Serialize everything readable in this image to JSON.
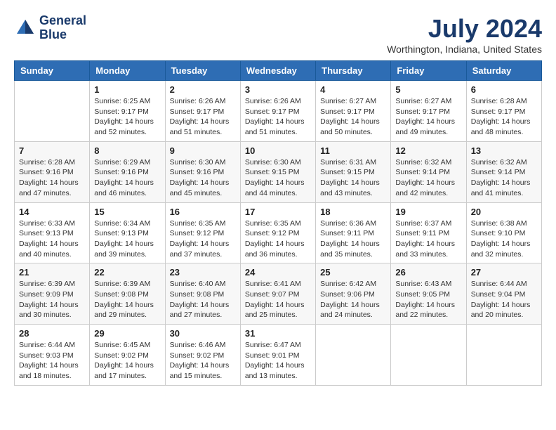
{
  "header": {
    "logo_line1": "General",
    "logo_line2": "Blue",
    "month_title": "July 2024",
    "location": "Worthington, Indiana, United States"
  },
  "weekdays": [
    "Sunday",
    "Monday",
    "Tuesday",
    "Wednesday",
    "Thursday",
    "Friday",
    "Saturday"
  ],
  "weeks": [
    [
      {
        "day": "",
        "info": ""
      },
      {
        "day": "1",
        "info": "Sunrise: 6:25 AM\nSunset: 9:17 PM\nDaylight: 14 hours\nand 52 minutes."
      },
      {
        "day": "2",
        "info": "Sunrise: 6:26 AM\nSunset: 9:17 PM\nDaylight: 14 hours\nand 51 minutes."
      },
      {
        "day": "3",
        "info": "Sunrise: 6:26 AM\nSunset: 9:17 PM\nDaylight: 14 hours\nand 51 minutes."
      },
      {
        "day": "4",
        "info": "Sunrise: 6:27 AM\nSunset: 9:17 PM\nDaylight: 14 hours\nand 50 minutes."
      },
      {
        "day": "5",
        "info": "Sunrise: 6:27 AM\nSunset: 9:17 PM\nDaylight: 14 hours\nand 49 minutes."
      },
      {
        "day": "6",
        "info": "Sunrise: 6:28 AM\nSunset: 9:17 PM\nDaylight: 14 hours\nand 48 minutes."
      }
    ],
    [
      {
        "day": "7",
        "info": "Sunrise: 6:28 AM\nSunset: 9:16 PM\nDaylight: 14 hours\nand 47 minutes."
      },
      {
        "day": "8",
        "info": "Sunrise: 6:29 AM\nSunset: 9:16 PM\nDaylight: 14 hours\nand 46 minutes."
      },
      {
        "day": "9",
        "info": "Sunrise: 6:30 AM\nSunset: 9:16 PM\nDaylight: 14 hours\nand 45 minutes."
      },
      {
        "day": "10",
        "info": "Sunrise: 6:30 AM\nSunset: 9:15 PM\nDaylight: 14 hours\nand 44 minutes."
      },
      {
        "day": "11",
        "info": "Sunrise: 6:31 AM\nSunset: 9:15 PM\nDaylight: 14 hours\nand 43 minutes."
      },
      {
        "day": "12",
        "info": "Sunrise: 6:32 AM\nSunset: 9:14 PM\nDaylight: 14 hours\nand 42 minutes."
      },
      {
        "day": "13",
        "info": "Sunrise: 6:32 AM\nSunset: 9:14 PM\nDaylight: 14 hours\nand 41 minutes."
      }
    ],
    [
      {
        "day": "14",
        "info": "Sunrise: 6:33 AM\nSunset: 9:13 PM\nDaylight: 14 hours\nand 40 minutes."
      },
      {
        "day": "15",
        "info": "Sunrise: 6:34 AM\nSunset: 9:13 PM\nDaylight: 14 hours\nand 39 minutes."
      },
      {
        "day": "16",
        "info": "Sunrise: 6:35 AM\nSunset: 9:12 PM\nDaylight: 14 hours\nand 37 minutes."
      },
      {
        "day": "17",
        "info": "Sunrise: 6:35 AM\nSunset: 9:12 PM\nDaylight: 14 hours\nand 36 minutes."
      },
      {
        "day": "18",
        "info": "Sunrise: 6:36 AM\nSunset: 9:11 PM\nDaylight: 14 hours\nand 35 minutes."
      },
      {
        "day": "19",
        "info": "Sunrise: 6:37 AM\nSunset: 9:11 PM\nDaylight: 14 hours\nand 33 minutes."
      },
      {
        "day": "20",
        "info": "Sunrise: 6:38 AM\nSunset: 9:10 PM\nDaylight: 14 hours\nand 32 minutes."
      }
    ],
    [
      {
        "day": "21",
        "info": "Sunrise: 6:39 AM\nSunset: 9:09 PM\nDaylight: 14 hours\nand 30 minutes."
      },
      {
        "day": "22",
        "info": "Sunrise: 6:39 AM\nSunset: 9:08 PM\nDaylight: 14 hours\nand 29 minutes."
      },
      {
        "day": "23",
        "info": "Sunrise: 6:40 AM\nSunset: 9:08 PM\nDaylight: 14 hours\nand 27 minutes."
      },
      {
        "day": "24",
        "info": "Sunrise: 6:41 AM\nSunset: 9:07 PM\nDaylight: 14 hours\nand 25 minutes."
      },
      {
        "day": "25",
        "info": "Sunrise: 6:42 AM\nSunset: 9:06 PM\nDaylight: 14 hours\nand 24 minutes."
      },
      {
        "day": "26",
        "info": "Sunrise: 6:43 AM\nSunset: 9:05 PM\nDaylight: 14 hours\nand 22 minutes."
      },
      {
        "day": "27",
        "info": "Sunrise: 6:44 AM\nSunset: 9:04 PM\nDaylight: 14 hours\nand 20 minutes."
      }
    ],
    [
      {
        "day": "28",
        "info": "Sunrise: 6:44 AM\nSunset: 9:03 PM\nDaylight: 14 hours\nand 18 minutes."
      },
      {
        "day": "29",
        "info": "Sunrise: 6:45 AM\nSunset: 9:02 PM\nDaylight: 14 hours\nand 17 minutes."
      },
      {
        "day": "30",
        "info": "Sunrise: 6:46 AM\nSunset: 9:02 PM\nDaylight: 14 hours\nand 15 minutes."
      },
      {
        "day": "31",
        "info": "Sunrise: 6:47 AM\nSunset: 9:01 PM\nDaylight: 14 hours\nand 13 minutes."
      },
      {
        "day": "",
        "info": ""
      },
      {
        "day": "",
        "info": ""
      },
      {
        "day": "",
        "info": ""
      }
    ]
  ]
}
